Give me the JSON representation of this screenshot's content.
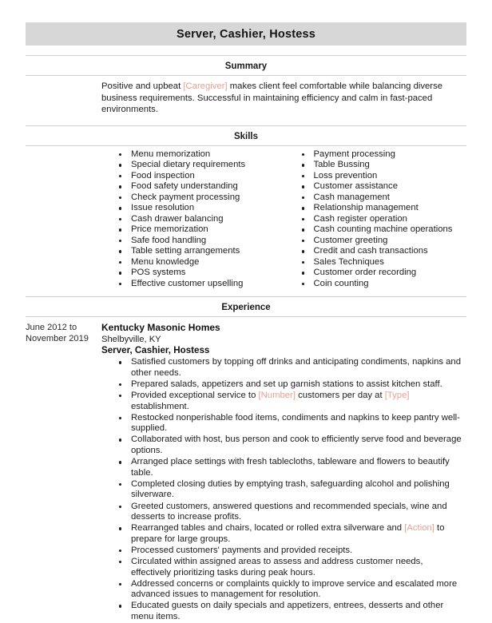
{
  "document": {
    "header_title": "Server, Cashier, Hostess",
    "accent_placeholder_color": "#e79f90",
    "header_band_color": "#d7d7d7",
    "rule_color": "#d2d2d2"
  },
  "sections": {
    "summary": {
      "heading": "Summary",
      "text_part_1": "Positive and upbeat ",
      "placeholder_1": "[Caregiver]",
      "text_part_2": " makes client feel comfortable while balancing diverse business requirements. Successful in maintaining efficiency and calm in fast-paced environments."
    },
    "skills": {
      "heading": "Skills",
      "column_left": [
        "Menu memorization",
        "Special dietary requirements",
        "Food inspection",
        "Food safety understanding",
        "Check payment processing",
        "Issue resolution",
        "Cash drawer balancing",
        "Price memorization",
        "Safe food handling",
        "Table setting arrangements",
        "Menu knowledge",
        "POS systems",
        "Effective customer upselling"
      ],
      "column_right": [
        "Payment processing",
        "Table Bussing",
        "Loss prevention",
        "Customer assistance",
        "Cash management",
        "Relationship management",
        "Cash register operation",
        "Cash counting machine operations",
        "Customer greeting",
        "Credit and cash transactions",
        "Sales Techniques",
        "Customer order recording",
        "Coin counting"
      ]
    },
    "experience": {
      "heading": "Experience",
      "entries": [
        {
          "dates": "June 2012 to November 2019",
          "company": "Kentucky Masonic Homes",
          "location": "Shelbyville, KY",
          "job_title": "Server, Cashier, Hostess",
          "duties": [
            {
              "text": "Satisfied customers by topping off drinks and anticipating condiments, napkins and other needs."
            },
            {
              "text": "Prepared salads, appetizers and set up garnish stations to assist kitchen staff."
            },
            {
              "pre": "Provided exceptional service to ",
              "ph1": "[Number]",
              "mid": " customers per day at ",
              "ph2": "[Type]",
              "post": " establishment."
            },
            {
              "text": "Restocked nonperishable food items, condiments and napkins to keep pantry well-supplied."
            },
            {
              "text": "Collaborated with host, bus person and cook to efficiently serve food and beverage options."
            },
            {
              "text": "Arranged place settings with fresh tablecloths, tableware and flowers to beautify table."
            },
            {
              "text": "Completed closing duties by emptying trash, safeguarding alcohol and polishing silverware."
            },
            {
              "text": "Greeted customers, answered questions and recommended specials, wine and desserts to increase profits."
            },
            {
              "pre": "Rearranged tables and chairs, located or rolled extra silverware and ",
              "ph1": "[Action]",
              "mid": " to prepare for large groups.",
              "post": ""
            },
            {
              "text": "Processed customers' payments and provided receipts."
            },
            {
              "text": "Circulated within assigned areas to assess and address customer needs, effectively prioritizing tasks during peak hours."
            },
            {
              "text": "Addressed concerns or complaints quickly to improve service and escalated more advanced issues to management for resolution."
            },
            {
              "text": "Educated guests on daily specials and appetizers, entrees, desserts and other menu items."
            }
          ]
        }
      ]
    }
  }
}
